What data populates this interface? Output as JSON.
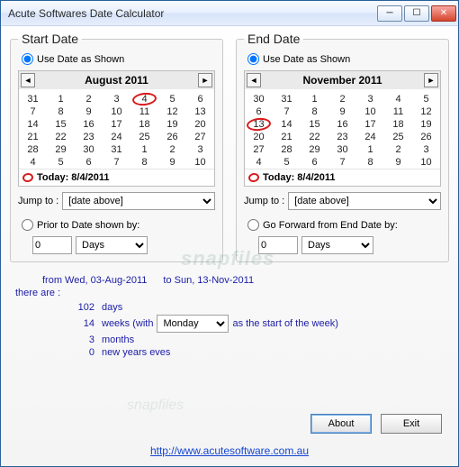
{
  "window": {
    "title": "Acute Softwares Date Calculator"
  },
  "start_panel": {
    "legend": "Start Date",
    "use_as_shown": "Use Date as Shown",
    "calendar": {
      "title": "August 2011",
      "dow": [
        "",
        "",
        "",
        "",
        "",
        "",
        ""
      ],
      "rows": [
        [
          "31",
          "1",
          "2",
          "3",
          "4",
          "5",
          "6"
        ],
        [
          "7",
          "8",
          "9",
          "10",
          "11",
          "12",
          "13"
        ],
        [
          "14",
          "15",
          "16",
          "17",
          "18",
          "19",
          "20"
        ],
        [
          "21",
          "22",
          "23",
          "24",
          "25",
          "26",
          "27"
        ],
        [
          "28",
          "29",
          "30",
          "31",
          "1",
          "2",
          "3"
        ],
        [
          "4",
          "5",
          "6",
          "7",
          "8",
          "9",
          "10"
        ]
      ],
      "circled_index": [
        0,
        4
      ],
      "off_cells": [
        [
          0,
          0
        ],
        [
          4,
          4
        ],
        [
          4,
          5
        ],
        [
          4,
          6
        ],
        [
          5,
          0
        ],
        [
          5,
          1
        ],
        [
          5,
          2
        ],
        [
          5,
          3
        ],
        [
          5,
          4
        ],
        [
          5,
          5
        ],
        [
          5,
          6
        ]
      ],
      "today": "Today: 8/4/2011"
    },
    "jump_label": "Jump to :",
    "jump_value": "[date above]",
    "prior_label": "Prior to Date shown by:",
    "offset_value": "0",
    "offset_unit": "Days"
  },
  "end_panel": {
    "legend": "End Date",
    "use_as_shown": "Use Date as Shown",
    "calendar": {
      "title": "November 2011",
      "rows": [
        [
          "30",
          "31",
          "1",
          "2",
          "3",
          "4",
          "5"
        ],
        [
          "6",
          "7",
          "8",
          "9",
          "10",
          "11",
          "12"
        ],
        [
          "13",
          "14",
          "15",
          "16",
          "17",
          "18",
          "19"
        ],
        [
          "20",
          "21",
          "22",
          "23",
          "24",
          "25",
          "26"
        ],
        [
          "27",
          "28",
          "29",
          "30",
          "1",
          "2",
          "3"
        ],
        [
          "4",
          "5",
          "6",
          "7",
          "8",
          "9",
          "10"
        ]
      ],
      "circled_index": [
        2,
        0
      ],
      "off_cells": [
        [
          0,
          0
        ],
        [
          0,
          1
        ],
        [
          4,
          4
        ],
        [
          4,
          5
        ],
        [
          4,
          6
        ],
        [
          5,
          0
        ],
        [
          5,
          1
        ],
        [
          5,
          2
        ],
        [
          5,
          3
        ],
        [
          5,
          4
        ],
        [
          5,
          5
        ],
        [
          5,
          6
        ]
      ],
      "today": "Today: 8/4/2011"
    },
    "jump_label": "Jump to :",
    "jump_value": "[date above]",
    "forward_label": "Go Forward from End Date by:",
    "offset_value": "0",
    "offset_unit": "Days"
  },
  "results": {
    "from": "from Wed, 03-Aug-2011",
    "to": "to Sun, 13-Nov-2011",
    "there_are": "there are :",
    "days_n": "102",
    "days_l": " days",
    "weeks_n": "14",
    "weeks_pre": " weeks (with",
    "weeks_sel": "Monday",
    "weeks_post": " as the start of the week)",
    "months_n": "3",
    "months_l": " months",
    "nye_n": "0",
    "nye_l": " new years eves"
  },
  "buttons": {
    "about": "About",
    "exit": "Exit"
  },
  "link": {
    "text": "http://www.acutesoftware.com.au",
    "href": "http://www.acutesoftware.com.au"
  }
}
